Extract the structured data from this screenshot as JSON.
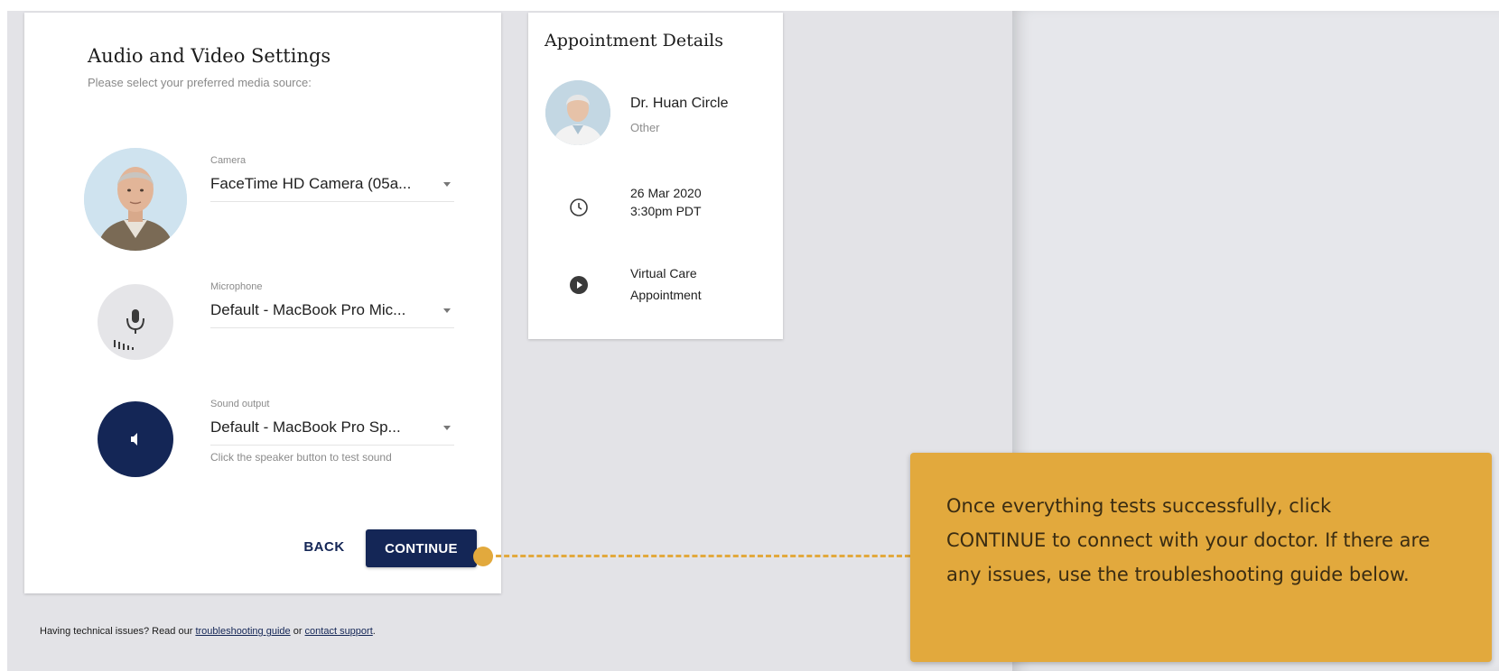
{
  "settings": {
    "title": "Audio and Video Settings",
    "subtitle": "Please select your preferred media source:",
    "camera": {
      "label": "Camera",
      "value": "FaceTime HD Camera (05a..."
    },
    "microphone": {
      "label": "Microphone",
      "value": "Default - MacBook Pro Mic..."
    },
    "sound_output": {
      "label": "Sound output",
      "value": "Default - MacBook Pro Sp...",
      "hint": "Click the speaker button to test sound"
    },
    "back_label": "BACK",
    "continue_label": "CONTINUE"
  },
  "help": {
    "prefix": "Having technical issues? Read our ",
    "guide_link": "troubleshooting guide",
    "middle": " or ",
    "support_link": "contact support",
    "suffix": "."
  },
  "appointment": {
    "title": "Appointment Details",
    "doctor_name": "Dr. Huan Circle",
    "doctor_specialty": "Other",
    "date": "26 Mar 2020",
    "time": "3:30pm PDT",
    "type_line1": "Virtual Care",
    "type_line2": "Appointment"
  },
  "callout": {
    "text": "Once everything tests successfully, click CONTINUE to connect with your doctor. If there are any issues, use the troubleshooting guide below."
  },
  "colors": {
    "navy": "#142656",
    "callout": "#e2a93d",
    "background": "#e3e3e7"
  },
  "icons": {
    "camera_preview": "person-photo",
    "microphone": "microphone-icon",
    "speaker": "speaker-icon",
    "clock": "clock-icon",
    "video": "play-circle-icon"
  }
}
